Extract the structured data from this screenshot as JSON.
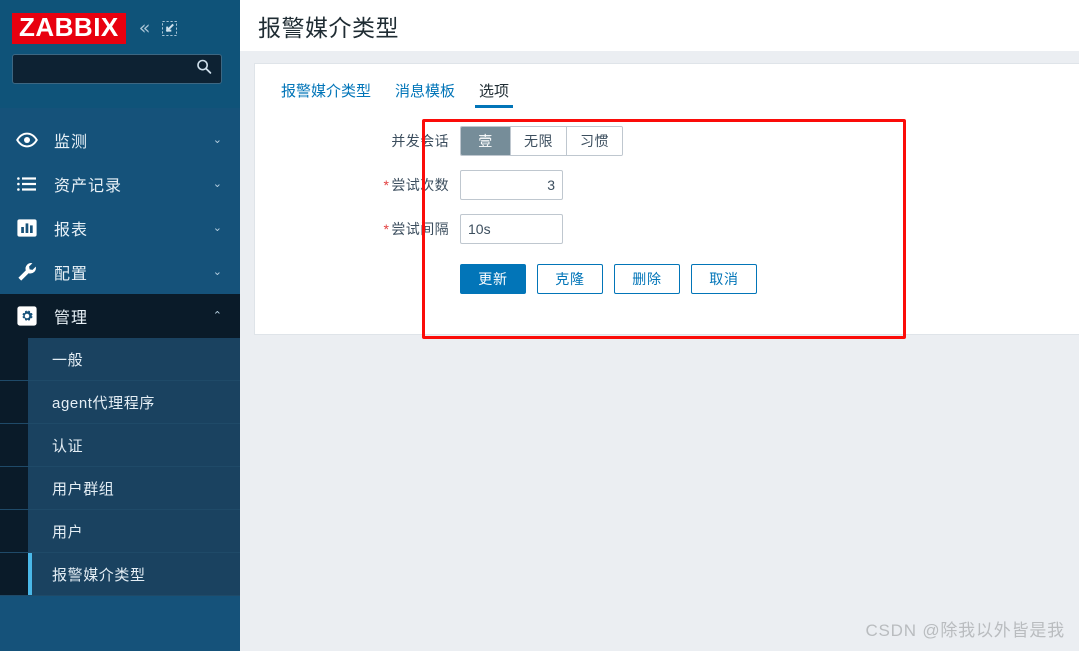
{
  "sidebar": {
    "logo": "ZABBIX",
    "collapse_icon": "chevron-double-left-icon",
    "compact_icon": "compact-view-icon",
    "search": {
      "value": "",
      "placeholder": "",
      "icon": "search-icon"
    },
    "nav": [
      {
        "label": "监测",
        "icon": "eye-icon",
        "arrow": "⌄",
        "active": false
      },
      {
        "label": "资产记录",
        "icon": "list-icon",
        "arrow": "⌄",
        "active": false
      },
      {
        "label": "报表",
        "icon": "chart-icon",
        "arrow": "⌄",
        "active": false
      },
      {
        "label": "配置",
        "icon": "wrench-icon",
        "arrow": "⌄",
        "active": false
      },
      {
        "label": "管理",
        "icon": "gear-icon",
        "arrow": "⌃",
        "active": true
      }
    ],
    "submenu": [
      {
        "label": "一般",
        "active": false
      },
      {
        "label": "agent代理程序",
        "active": false
      },
      {
        "label": "认证",
        "active": false
      },
      {
        "label": "用户群组",
        "active": false
      },
      {
        "label": "用户",
        "active": false
      },
      {
        "label": "报警媒介类型",
        "active": true
      }
    ]
  },
  "header": {
    "title": "报警媒介类型"
  },
  "tabs": [
    {
      "label": "报警媒介类型",
      "active": false
    },
    {
      "label": "消息模板",
      "active": false
    },
    {
      "label": "选项",
      "active": true
    }
  ],
  "form": {
    "concurrent_sessions": {
      "label": "并发会话",
      "required": false,
      "options": [
        "壹",
        "无限",
        "习惯"
      ],
      "selected": "壹"
    },
    "attempts": {
      "label": "尝试次数",
      "required": true,
      "required_mark": "*",
      "value": "3",
      "placeholder": ""
    },
    "attempt_interval": {
      "label": "尝试间隔",
      "required": true,
      "required_mark": "*",
      "value": "10s",
      "placeholder": ""
    },
    "buttons": [
      {
        "label": "更新",
        "style": "primary"
      },
      {
        "label": "克隆",
        "style": "secondary"
      },
      {
        "label": "删除",
        "style": "secondary"
      },
      {
        "label": "取消",
        "style": "secondary"
      }
    ]
  },
  "annotation": {
    "color": "#fb0c09",
    "name": "red-highlight-box"
  },
  "watermark": "CSDN @除我以外皆是我"
}
